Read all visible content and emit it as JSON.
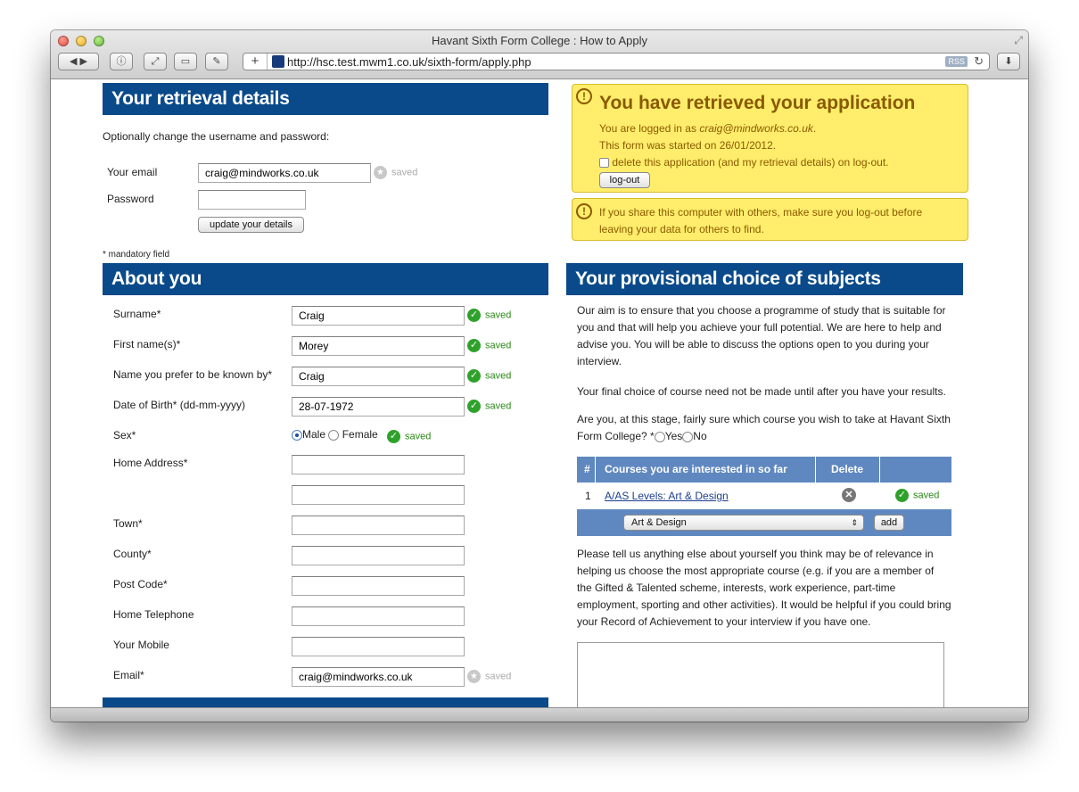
{
  "window": {
    "title": "Havant Sixth Form College : How to Apply"
  },
  "browser": {
    "url": "http://hsc.test.mwm1.co.uk/sixth-form/apply.php",
    "rss_label": "RSS"
  },
  "retrieval": {
    "heading": "Your retrieval details",
    "intro": "Optionally change the username and password:",
    "email_label": "Your email",
    "email_value": "craig@mindworks.co.uk",
    "email_status": "saved",
    "password_label": "Password",
    "password_value": "",
    "update_button": "update your details",
    "mandatory_note": "* mandatory field"
  },
  "notice": {
    "title": "You have retrieved your application",
    "logged_in_prefix": "You are logged in as ",
    "logged_in_email": "craig@mindworks.co.uk",
    "logged_in_suffix": ".",
    "started": "This form was started on 26/01/2012.",
    "delete_label": "delete this application (and my retrieval details) on log-out.",
    "logout_button": "log-out",
    "warning": "If you share this computer with others, make sure you log-out before leaving your data for others to find."
  },
  "about": {
    "heading": "About you",
    "fields": [
      {
        "label": "Surname*",
        "value": "Craig",
        "status": "saved"
      },
      {
        "label": "First name(s)*",
        "value": "Morey",
        "status": "saved"
      },
      {
        "label": "Name you prefer to be known by*",
        "value": "Craig",
        "status": "saved"
      },
      {
        "label": "Date of Birth* (dd-mm-yyyy)",
        "value": "28-07-1972",
        "status": "saved"
      }
    ],
    "sex_label": "Sex*",
    "sex_options": [
      "Male",
      "Female"
    ],
    "sex_selected": "Male",
    "sex_status": "saved",
    "address_label": "Home Address*",
    "address_line1": "",
    "address_line2": "",
    "town_label": "Town*",
    "town_value": "",
    "county_label": "County*",
    "county_value": "",
    "postcode_label": "Post Code*",
    "postcode_value": "",
    "home_tel_label": "Home Telephone",
    "home_tel_value": "",
    "mobile_label": "Your Mobile",
    "mobile_value": "",
    "email_label": "Email*",
    "email_value": "craig@mindworks.co.uk",
    "email_status": "saved"
  },
  "subjects": {
    "heading": "Your provisional choice of subjects",
    "intro1": "Our aim is to ensure that you choose a programme of study that is suitable for you and that will help you achieve your full potential. We are here to help and advise you. You will be able to discuss the options open to you during your interview.",
    "intro2": "Your final choice of course need not be made until after you have your results.",
    "question": "Are you, at this stage, fairly sure which course you wish to take at Havant Sixth Form College? *",
    "answer_options": [
      "Yes",
      "No"
    ],
    "table_headers": [
      "#",
      "Courses you are interested in so far",
      "Delete"
    ],
    "rows": [
      {
        "num": "1",
        "course": "A/AS Levels: Art & Design",
        "status": "saved"
      }
    ],
    "select_value": "Art & Design",
    "add_button": "add",
    "tell_us": "Please tell us anything else about yourself you think may be of relevance in helping us choose the most appropriate course (e.g. if you are a member of the Gifted & Talented scheme, interests, work experience, part-time employment, sporting and other activities). It would be helpful if you could bring your Record of Achievement to your interview if you have one.",
    "textarea_value": ""
  },
  "colors": {
    "heading_bg": "#0a4a8a",
    "notice_bg": "#ffed6b",
    "table_head_bg": "#6088c0",
    "saved_green": "#2a8a16"
  }
}
